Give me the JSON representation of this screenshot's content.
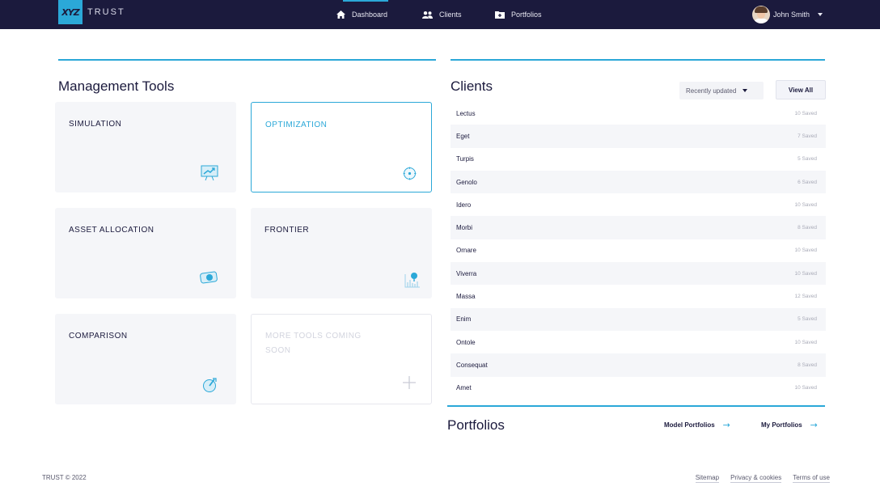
{
  "brand": {
    "logo_mark": "XYZ",
    "name": "TRUST"
  },
  "nav": {
    "items": [
      {
        "label": "Dashboard",
        "icon": "home-icon"
      },
      {
        "label": "Clients",
        "icon": "users-icon"
      },
      {
        "label": "Portfolios",
        "icon": "folder-icon"
      }
    ],
    "active": "Dashboard"
  },
  "user": {
    "name": "John Smith",
    "icon": "avatar"
  },
  "management": {
    "title": "Management Tools",
    "tools": [
      {
        "label": "SIMULATION",
        "icon": "presentation-chart-icon"
      },
      {
        "label": "OPTIMIZATION",
        "icon": "target-icon"
      },
      {
        "label": "ASSET ALLOCATION",
        "icon": "banknote-icon"
      },
      {
        "label": "FRONTIER",
        "icon": "chart-pin-icon"
      },
      {
        "label": "COMPARISON",
        "icon": "gauge-icon"
      },
      {
        "label": "MORE TOOLS COMING SOON",
        "icon": "plus-icon"
      }
    ]
  },
  "clients": {
    "title": "Clients",
    "sort_label": "Recently updated",
    "view_all": "View All",
    "rows": [
      {
        "name": "Lectus",
        "saved": "10 Saved"
      },
      {
        "name": "Eget",
        "saved": "7 Saved"
      },
      {
        "name": "Turpis",
        "saved": "5 Saved"
      },
      {
        "name": "Genolo",
        "saved": "6 Saved"
      },
      {
        "name": "Idero",
        "saved": "10 Saved"
      },
      {
        "name": "Morbi",
        "saved": "8 Saved"
      },
      {
        "name": "Ornare",
        "saved": "10 Saved"
      },
      {
        "name": "Viverra",
        "saved": "10 Saved"
      },
      {
        "name": "Massa",
        "saved": "12 Saved"
      },
      {
        "name": "Enim",
        "saved": "5 Saved"
      },
      {
        "name": "Ontole",
        "saved": "10 Saved"
      },
      {
        "name": "Consequat",
        "saved": "8 Saved"
      },
      {
        "name": "Amet",
        "saved": "10 Saved"
      }
    ]
  },
  "portfolios": {
    "title": "Portfolios",
    "links": [
      {
        "label": "Model Portfolios"
      },
      {
        "label": "My Portfolios"
      }
    ]
  },
  "footer": {
    "copyright": "TRUST © 2022",
    "links": [
      "Sitemap",
      "Privacy & cookies",
      "Terms of use"
    ]
  },
  "colors": {
    "nav_bg": "#1b1a3d",
    "accent": "#2ba8d8",
    "card_bg": "#f5f6f9"
  }
}
